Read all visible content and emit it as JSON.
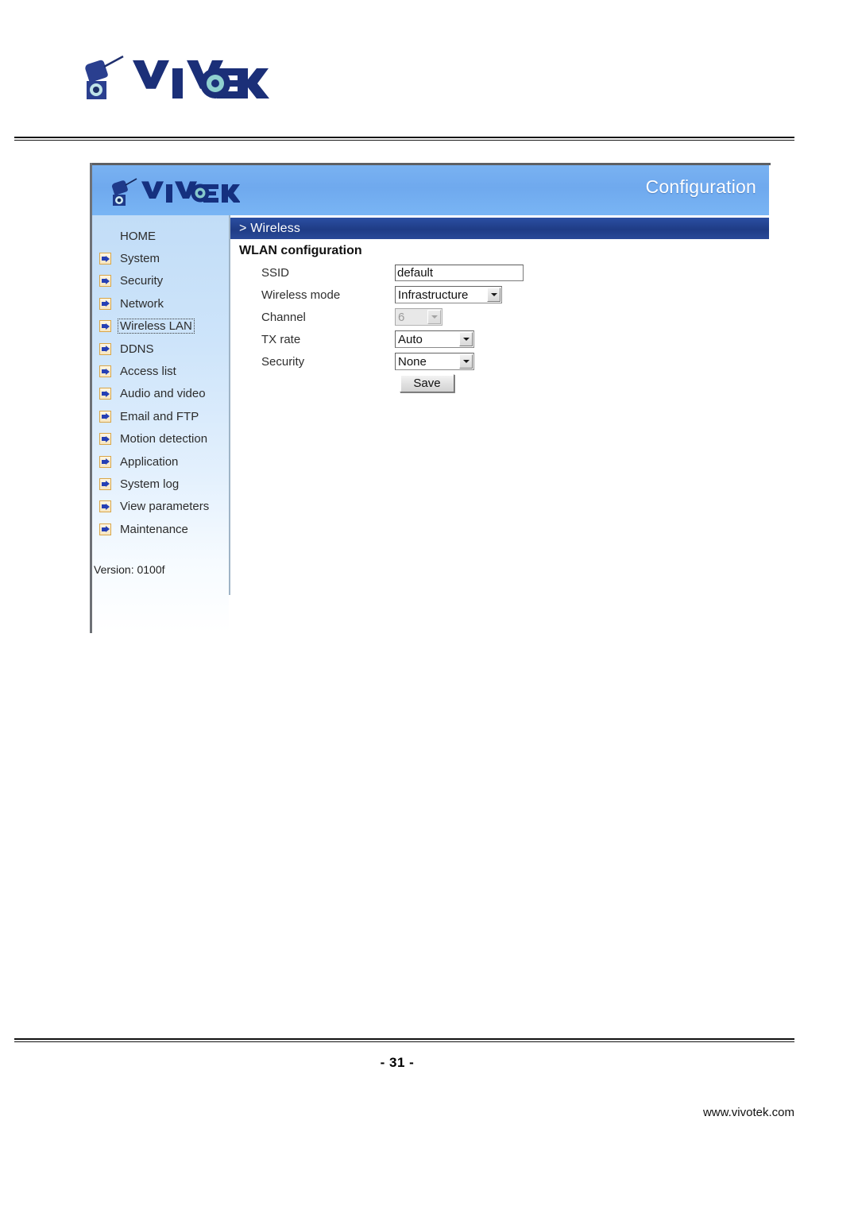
{
  "document": {
    "brand": "VIVOTEK",
    "page_number": "- 31 -",
    "url": "www.vivotek.com"
  },
  "ui": {
    "header": {
      "brand": "VIVOTEK",
      "title": "Configuration"
    },
    "sidebar": {
      "items": [
        {
          "label": "HOME",
          "icon": "",
          "active": false
        },
        {
          "label": "System",
          "icon": "arrow-icon",
          "active": false
        },
        {
          "label": "Security",
          "icon": "arrow-icon",
          "active": false
        },
        {
          "label": "Network",
          "icon": "arrow-icon",
          "active": false
        },
        {
          "label": "Wireless LAN",
          "icon": "arrow-icon",
          "active": true
        },
        {
          "label": "DDNS",
          "icon": "arrow-icon",
          "active": false
        },
        {
          "label": "Access list",
          "icon": "arrow-icon",
          "active": false
        },
        {
          "label": "Audio and video",
          "icon": "arrow-icon",
          "active": false
        },
        {
          "label": "Email and FTP",
          "icon": "arrow-icon",
          "active": false
        },
        {
          "label": "Motion detection",
          "icon": "arrow-icon",
          "active": false
        },
        {
          "label": "Application",
          "icon": "arrow-icon",
          "active": false
        },
        {
          "label": "System log",
          "icon": "arrow-icon",
          "active": false
        },
        {
          "label": "View parameters",
          "icon": "arrow-icon",
          "active": false
        },
        {
          "label": "Maintenance",
          "icon": "arrow-icon",
          "active": false
        }
      ],
      "version": "Version: 0100f"
    },
    "content": {
      "section_bar": "> Wireless",
      "heading": "WLAN configuration",
      "fields": {
        "ssid": {
          "label": "SSID",
          "value": "default",
          "placeholder": ""
        },
        "wireless_mode": {
          "label": "Wireless mode",
          "value": "Infrastructure"
        },
        "channel": {
          "label": "Channel",
          "value": "6",
          "disabled": true
        },
        "tx_rate": {
          "label": "TX rate",
          "value": "Auto"
        },
        "security": {
          "label": "Security",
          "value": "None"
        }
      },
      "save_label": "Save"
    }
  },
  "colors": {
    "header_blue": "#6fa9ee",
    "section_bar_blue": "#1f3c86",
    "sidebar_blue": "#c2ddf7",
    "icon_orange": "#d9a648",
    "icon_arrow_blue": "#2540b5"
  }
}
